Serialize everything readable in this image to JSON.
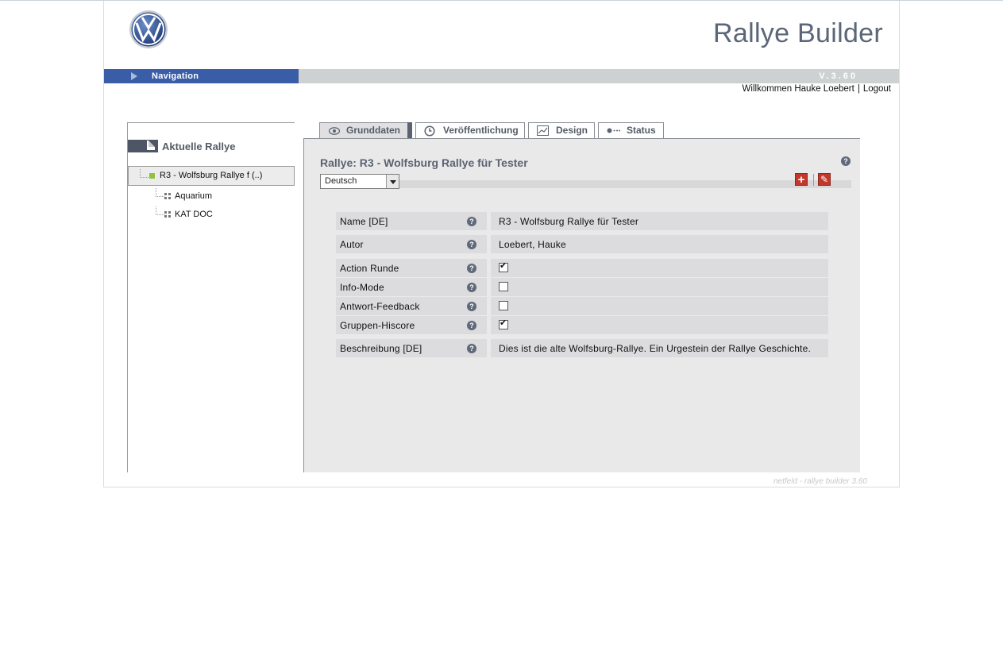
{
  "app": {
    "title": "Rallye Builder",
    "version": "V.3.60"
  },
  "nav": {
    "label": "Navigation"
  },
  "user": {
    "welcome": "Willkommen Hauke Loebert",
    "separator": "|",
    "logout": "Logout"
  },
  "sidebar": {
    "title": "Aktuelle Rallye",
    "root": "R3 - Wolfsburg Rallye f (..)",
    "children": [
      "Aquarium",
      "KAT DOC"
    ]
  },
  "tabs": [
    {
      "label": "Grunddaten",
      "icon": "eye-icon",
      "active": true
    },
    {
      "label": "Veröffentlichung",
      "icon": "clock-icon",
      "active": false
    },
    {
      "label": "Design",
      "icon": "chart-icon",
      "active": false
    },
    {
      "label": "Status",
      "icon": "status-icon",
      "active": false
    }
  ],
  "main": {
    "title": "Rallye: R3 - Wolfsburg Rallye für Tester",
    "language": "Deutsch",
    "help": "?"
  },
  "fields": [
    {
      "label": "Name [DE]",
      "value": "R3 - Wolfsburg Rallye für Tester"
    },
    {
      "label": "Autor",
      "value": "Loebert, Hauke"
    },
    {
      "label": "Action Runde",
      "checked": true
    },
    {
      "label": "Info-Mode",
      "checked": false
    },
    {
      "label": "Antwort-Feedback",
      "checked": false
    },
    {
      "label": "Gruppen-Hiscore",
      "checked": true
    },
    {
      "label": "Beschreibung [DE]",
      "value": "Dies ist die alte Wolfsburg-Rallye. Ein Urgestein der Rallye Geschichte."
    }
  ],
  "footer": "netfeld - rallye builder 3.60",
  "colors": {
    "nav_blue": "#3a5da8",
    "accent_red": "#c0392b",
    "tree_green": "#8ec23f"
  }
}
